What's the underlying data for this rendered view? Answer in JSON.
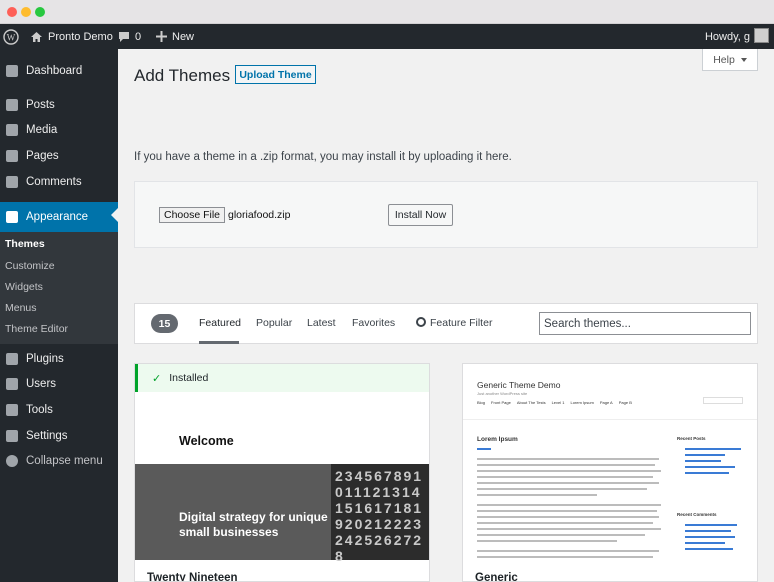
{
  "window": {},
  "adminbar": {
    "site_name": "Pronto Demo",
    "comments_count": "0",
    "new_label": "New",
    "howdy": "Howdy, g"
  },
  "sidebar": {
    "items": [
      {
        "label": "Dashboard",
        "icon": "dashboard-icon"
      },
      {
        "label": "Posts",
        "icon": "pin-icon"
      },
      {
        "label": "Media",
        "icon": "media-icon"
      },
      {
        "label": "Pages",
        "icon": "pages-icon"
      },
      {
        "label": "Comments",
        "icon": "comment-icon"
      },
      {
        "label": "Appearance",
        "icon": "brush-icon"
      },
      {
        "label": "Plugins",
        "icon": "plug-icon"
      },
      {
        "label": "Users",
        "icon": "users-icon"
      },
      {
        "label": "Tools",
        "icon": "wrench-icon"
      },
      {
        "label": "Settings",
        "icon": "settings-icon"
      },
      {
        "label": "Collapse menu",
        "icon": "collapse-icon"
      }
    ],
    "submenu": [
      "Themes",
      "Customize",
      "Widgets",
      "Menus",
      "Theme Editor"
    ]
  },
  "page": {
    "title": "Add Themes",
    "upload_button": "Upload Theme",
    "help_label": "Help"
  },
  "upload": {
    "instructions": "If you have a theme in a .zip format, you may install it by uploading it here.",
    "choose_file_label": "Choose File",
    "file_name": "gloriafood.zip",
    "install_label": "Install Now"
  },
  "filter": {
    "count": "15",
    "tabs": [
      "Featured",
      "Popular",
      "Latest",
      "Favorites"
    ],
    "feature_filter_label": "Feature Filter",
    "search_placeholder": "Search themes..."
  },
  "themes": [
    {
      "name": "Twenty Nineteen",
      "installed_label": "Installed",
      "preview_heading": "Welcome",
      "preview_tagline": "Digital strategy for unique small businesses",
      "preview_calendar": "2345678910111213141516171819202122232425262728"
    },
    {
      "name": "Generic",
      "preview_title": "Generic Theme Demo",
      "preview_tagline": "Just another WordPress site",
      "preview_nav": [
        "Blog",
        "Front Page",
        "About The Tests",
        "Level 1",
        "Lorem Ipsum",
        "Page A",
        "Page B"
      ],
      "preview_heading": "Lorem Ipsum",
      "preview_sidebar_headings": [
        "Recent Posts",
        "Recent Comments"
      ]
    }
  ],
  "colors": {
    "accent": "#0073aa",
    "adminbar": "#23282d",
    "installed": "#00a32a"
  }
}
